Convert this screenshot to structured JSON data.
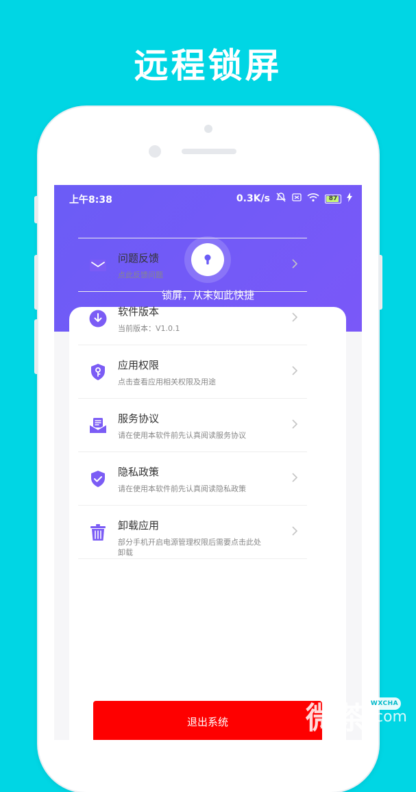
{
  "headline": "远程锁屏",
  "status_bar": {
    "time": "上午8:38",
    "network_speed": "0.3K/s",
    "battery_level": "87"
  },
  "hero": {
    "tagline": "锁屏，从未如此快捷",
    "icon": "keyhole-icon"
  },
  "menu": [
    {
      "icon": "mail-icon",
      "title": "问题反馈",
      "subtitle": "点此反馈问题"
    },
    {
      "icon": "download-icon",
      "title": "软件版本",
      "subtitle": "当前版本：V1.0.1"
    },
    {
      "icon": "shield-key-icon",
      "title": "应用权限",
      "subtitle": "点击查看应用相关权限及用途"
    },
    {
      "icon": "agreement-icon",
      "title": "服务协议",
      "subtitle": "请在使用本软件前先认真阅读服务协议"
    },
    {
      "icon": "shield-check-icon",
      "title": "隐私政策",
      "subtitle": "请在使用本软件前先认真阅读隐私政策"
    },
    {
      "icon": "trash-icon",
      "title": "卸载应用",
      "subtitle": "部分手机开启电源管理权限后需要点击此处卸载"
    }
  ],
  "exit_button": "退出系统",
  "watermark": {
    "cn": "微茶",
    "badge": "WXCHA",
    "domain": ".com"
  },
  "colors": {
    "background": "#00d6e4",
    "primary": "#6b5cf6",
    "exit": "#fe0000"
  }
}
